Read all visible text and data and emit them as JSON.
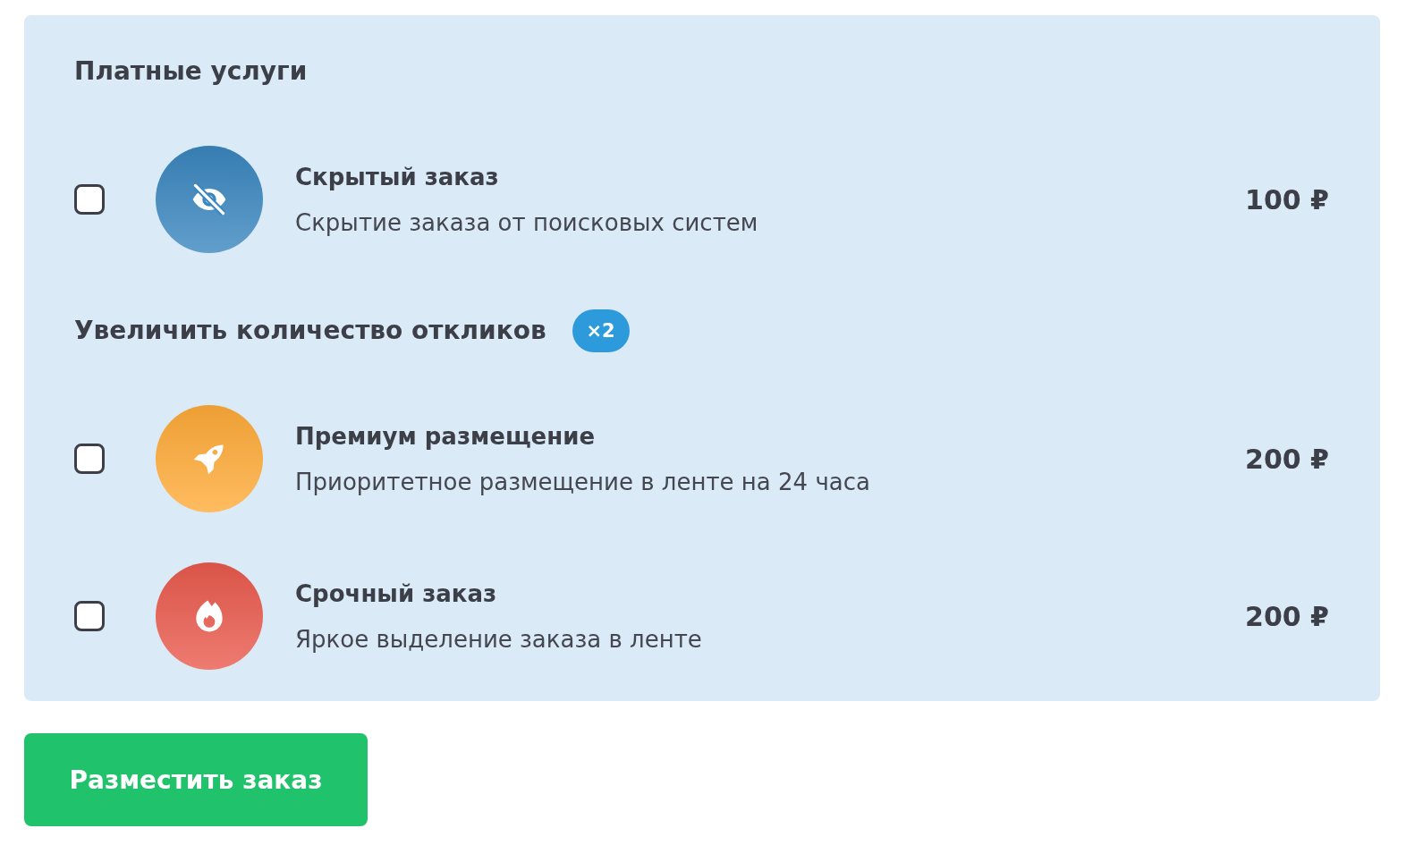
{
  "sections": [
    {
      "title": "Платные услуги",
      "items": [
        {
          "checked": false,
          "kind": "hidden",
          "color": "#3a86bf",
          "title": "Скрытый заказ",
          "description": "Скрытие заказа от поисковых систем",
          "price": "100 ₽"
        }
      ]
    },
    {
      "title": "Увеличить количество откликов",
      "badge": "×2",
      "items": [
        {
          "checked": false,
          "kind": "premium",
          "color": "#ffab38",
          "title": "Премиум размещение",
          "description": "Приоритетное размещение в ленте на 24 часа",
          "price": "200 ₽"
        },
        {
          "checked": false,
          "kind": "urgent",
          "color": "#ea5a4d",
          "title": "Срочный заказ",
          "description": "Яркое выделение заказа в ленте",
          "price": "200 ₽"
        }
      ]
    }
  ],
  "submit_button": "Разместить заказ"
}
